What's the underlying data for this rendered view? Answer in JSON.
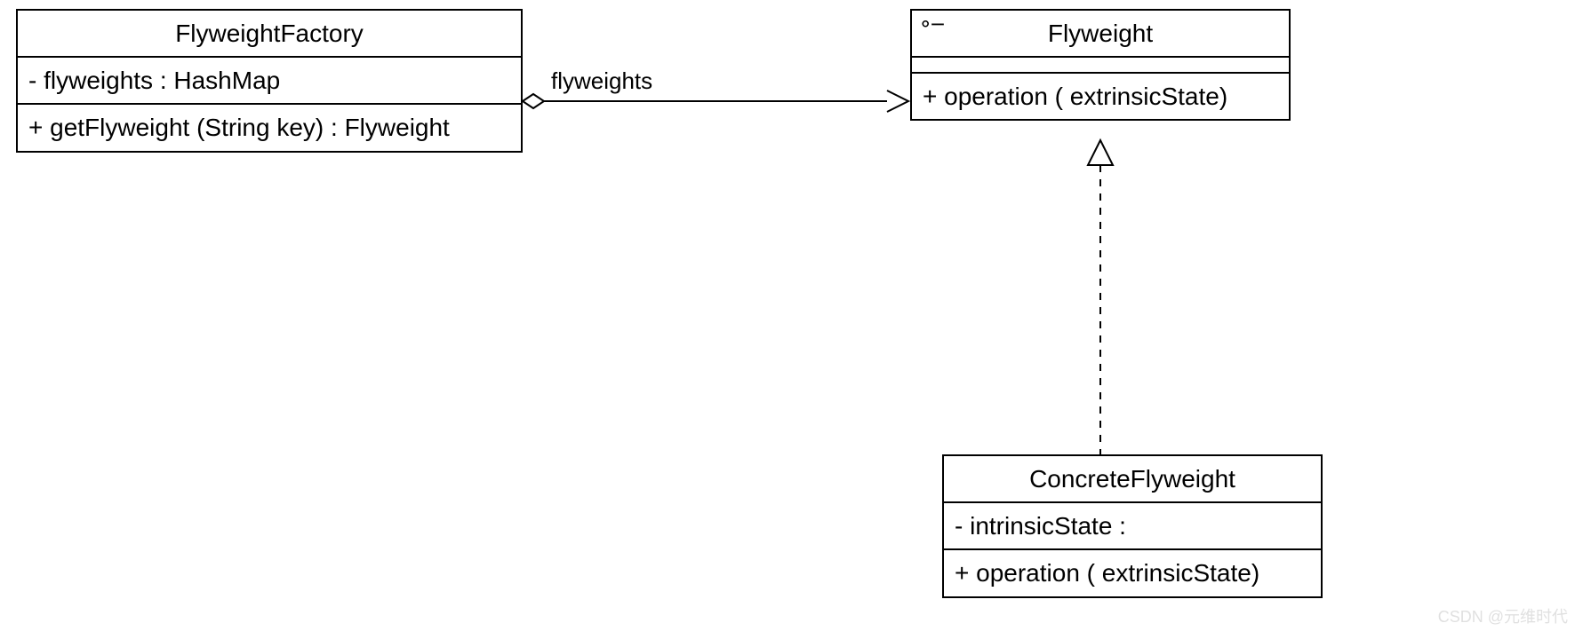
{
  "classes": {
    "factory": {
      "name": "FlyweightFactory",
      "attr": "-  flyweights  : HashMap",
      "op": "+  getFlyweight (String key)  : Flyweight"
    },
    "flyweight": {
      "name": "Flyweight",
      "op": "+  operation ( extrinsicState)",
      "iface_marker": "⚬─"
    },
    "concrete": {
      "name": "ConcreteFlyweight",
      "attr": "-  intrinsicState  :",
      "op": "+  operation ( extrinsicState)"
    }
  },
  "labels": {
    "aggregation": "flyweights"
  },
  "watermark": "CSDN @元维时代"
}
